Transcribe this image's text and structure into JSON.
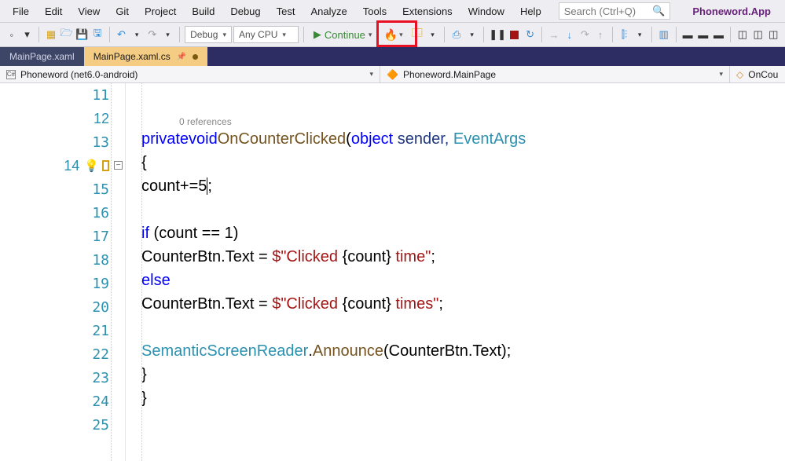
{
  "menu": {
    "items": [
      "File",
      "Edit",
      "View",
      "Git",
      "Project",
      "Build",
      "Debug",
      "Test",
      "Analyze",
      "Tools",
      "Extensions",
      "Window",
      "Help"
    ]
  },
  "search": {
    "placeholder": "Search (Ctrl+Q)"
  },
  "project_name": "Phoneword.App",
  "toolbar": {
    "config": "Debug",
    "platform": "Any CPU",
    "continue_label": "Continue"
  },
  "tabs": [
    {
      "label": "MainPage.xaml",
      "active": false
    },
    {
      "label": "MainPage.xaml.cs",
      "active": true,
      "pinned": true,
      "dirty": true
    }
  ],
  "breadcrumb": {
    "scope": "Phoneword (net6.0-android)",
    "class": "Phoneword.MainPage",
    "member": "OnCounterClicked(ob"
  },
  "references_label": "0 references",
  "lines": {
    "11": "11",
    "12": "12",
    "13": "13",
    "14": "14",
    "15": "15",
    "16": "16",
    "17": "17",
    "18": "18",
    "19": "19",
    "20": "20",
    "21": "21",
    "22": "22",
    "23": "23",
    "24": "24",
    "25": "25"
  },
  "code": {
    "l12": {
      "priv": "private",
      "void": "void",
      "name": "OnCounterClicked",
      "obj": "object",
      "sender": " sender, ",
      "evargs": "EventArgs"
    },
    "l13": "{",
    "l14": {
      "a": "count+=5",
      "b": ";"
    },
    "l16": {
      "if": "if",
      "cond": " (count == 1)"
    },
    "l17": {
      "a": "CounterBtn.Text = ",
      "s": "$\"Clicked ",
      "i": "{count}",
      "s2": " time\"",
      "semi": ";"
    },
    "l18": "else",
    "l19": {
      "a": "CounterBtn.Text = ",
      "s": "$\"Clicked ",
      "i": "{count}",
      "s2": " times\"",
      "semi": ";"
    },
    "l21": {
      "cls": "SemanticScreenReader",
      "dot": ".",
      "m": "Announce",
      "args": "(CounterBtn.Text);"
    },
    "l22": "}",
    "l23": "}"
  }
}
